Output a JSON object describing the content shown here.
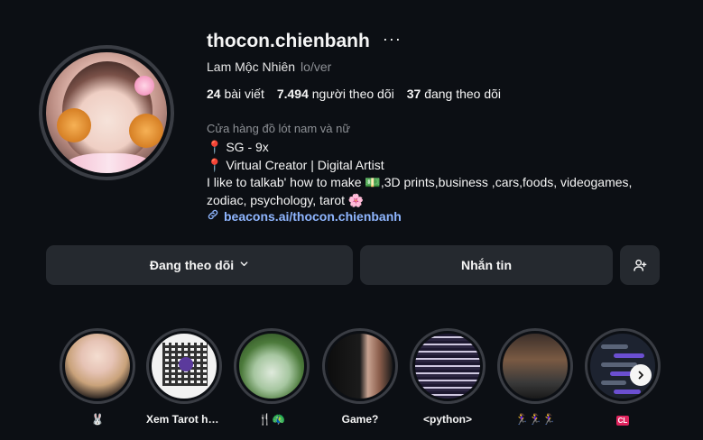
{
  "profile": {
    "username": "thocon.chienbanh",
    "more_glyph": "···",
    "full_name": "Lam Mộc Nhiên",
    "pronouns": "lo/ver",
    "stats": {
      "posts_count": "24",
      "posts_label": "bài viết",
      "followers_count": "7.494",
      "followers_label": "người theo dõi",
      "following_count": "37",
      "following_label": "đang theo dõi"
    },
    "category": "Cửa hàng đồ lót nam và nữ",
    "bio": {
      "line1": "SG - 9x",
      "line2": "Virtual Creator | Digital Artist",
      "line3": "I like to talkab' how to make 💵,3D prints,business ,cars,foods, videogames,",
      "line4": "zodiac, psychology, tarot 🌸"
    },
    "pin_glyph": "📍",
    "link_text": "beacons.ai/thocon.chienbanh"
  },
  "actions": {
    "following_label": "Đang theo dõi",
    "message_label": "Nhắn tin"
  },
  "highlights": [
    {
      "label": "🐰"
    },
    {
      "label": "Xem Tarot hô..."
    },
    {
      "label": "🍴🦚"
    },
    {
      "label": "Game?"
    },
    {
      "label": "<python>"
    },
    {
      "label": "🏃‍♀️🏃‍♀️🏃‍♀️"
    },
    {
      "label": "CL"
    }
  ],
  "icons": {
    "more": "more-horizontal-icon",
    "link": "link-icon",
    "chevron": "chevron-down-icon",
    "add_user": "add-user-icon",
    "next": "chevron-right-icon"
  },
  "colors": {
    "background": "#0c0f14",
    "button": "#25292f",
    "link": "#8fb6ff",
    "muted": "#8e9196"
  }
}
